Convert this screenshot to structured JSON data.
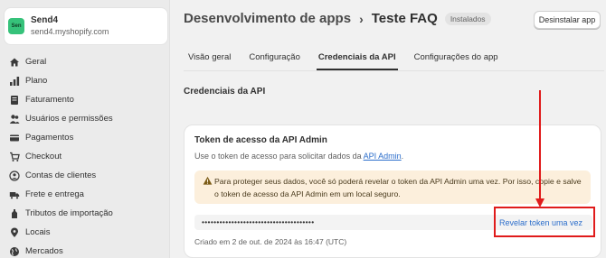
{
  "store": {
    "logo_text": "Sen",
    "name": "Send4",
    "domain": "send4.myshopify.com"
  },
  "sidebar": {
    "items": [
      {
        "label": "Geral",
        "icon": "home-icon"
      },
      {
        "label": "Plano",
        "icon": "chart-bars-icon"
      },
      {
        "label": "Faturamento",
        "icon": "receipt-icon"
      },
      {
        "label": "Usuários e permissões",
        "icon": "users-icon"
      },
      {
        "label": "Pagamentos",
        "icon": "card-icon"
      },
      {
        "label": "Checkout",
        "icon": "cart-icon"
      },
      {
        "label": "Contas de clientes",
        "icon": "person-icon"
      },
      {
        "label": "Frete e entrega",
        "icon": "truck-icon"
      },
      {
        "label": "Tributos de importação",
        "icon": "duty-icon"
      },
      {
        "label": "Locais",
        "icon": "pin-icon"
      },
      {
        "label": "Mercados",
        "icon": "globe-icon"
      }
    ]
  },
  "header": {
    "breadcrumb_parent": "Desenvolvimento de apps",
    "separator": "›",
    "current": "Teste FAQ",
    "badge": "Instalados",
    "uninstall_label": "Desinstalar app"
  },
  "tabs": [
    {
      "label": "Visão geral"
    },
    {
      "label": "Configuração"
    },
    {
      "label": "Credenciais da API",
      "active": true
    },
    {
      "label": "Configurações do app"
    }
  ],
  "section_title": "Credenciais da API",
  "card": {
    "title": "Token de acesso da API Admin",
    "desc_prefix": "Use o token de acesso para solicitar dados da ",
    "desc_link": "API Admin",
    "desc_suffix": ".",
    "warning": "Para proteger seus dados, você só poderá revelar o token da API Admin uma vez. Por isso, copie e salve o token de acesso da API Admin em um local seguro.",
    "token_mask": "••••••••••••••••••••••••••••••••••••••",
    "reveal_label": "Revelar token uma vez",
    "created": "Criado em 2 de out. de 2024 às 16:47 (UTC)"
  },
  "colors": {
    "accent": "#2c6ecb",
    "warning_bg": "#fcefdc",
    "annotation": "#e01b1b"
  }
}
